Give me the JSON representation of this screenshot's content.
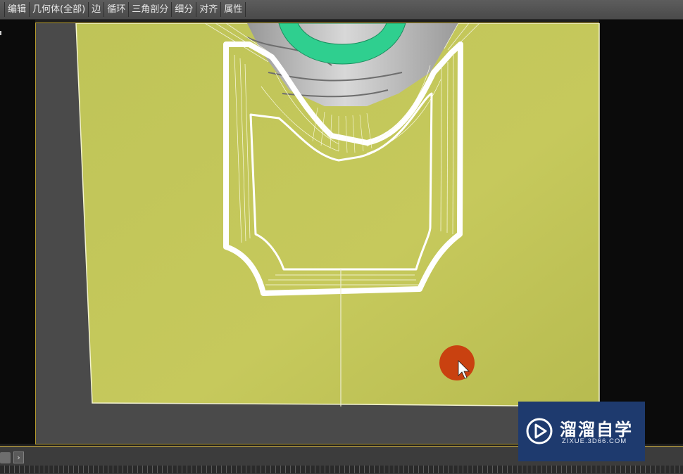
{
  "menu": {
    "items": [
      {
        "label": "编辑"
      },
      {
        "label": "几何体(全部)"
      },
      {
        "label": "边"
      },
      {
        "label": "循环"
      },
      {
        "label": "三角剖分"
      },
      {
        "label": "细分"
      },
      {
        "label": "对齐"
      },
      {
        "label": "属性"
      }
    ]
  },
  "statusbar": {
    "arrow": "›"
  },
  "watermark": {
    "brand": "溜溜自学",
    "url": "ZIXUE.3D66.COM"
  },
  "colors": {
    "plane": "#c3c65a",
    "viewport_bg": "#4a4a4a",
    "viewport_border": "#b39a2c",
    "cursor_marker": "#c94110",
    "torus": "#2fcf8f",
    "watermark_bg": "#1e3a6e"
  },
  "icons": {
    "cursor": "arrow-cursor-icon",
    "logo": "play-logo-icon"
  }
}
